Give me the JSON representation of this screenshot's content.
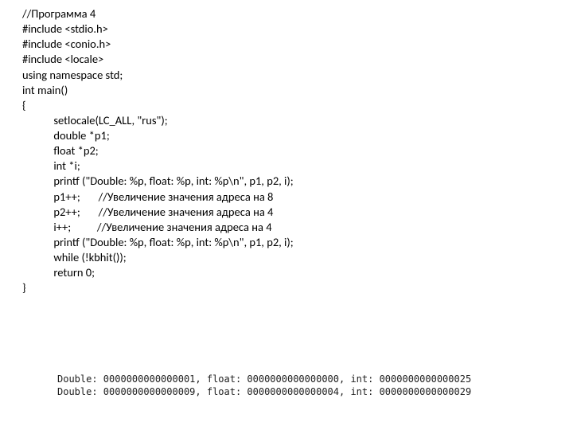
{
  "code": {
    "l0": "//Программа 4",
    "l1": "#include <stdio.h>",
    "l2": "#include <conio.h>",
    "l3": "#include <locale>",
    "l4": "using namespace std;",
    "l5": "int main()",
    "l6": "{",
    "l7": "            setlocale(LC_ALL, \"rus\");",
    "l8": "            double *p1;",
    "l9": "            float *p2;",
    "l10": "            int *i;",
    "l11": "            printf (\"Double: %p, float: %p, int: %p\\n\", p1, p2, i);",
    "l12": "            p1++;       //Увеличение значения адреса на 8",
    "l13": "            p2++;       //Увеличение значения адреса на 4",
    "l14": "            i++;          //Увеличение значения адреса на 4",
    "l15": "            printf (\"Double: %p, float: %p, int: %p\\n\", p1, p2, i);",
    "l16": "            while (!kbhit());",
    "l17": "            return 0;",
    "l18": "}"
  },
  "output": {
    "line1": "Double: 0000000000000001, float: 0000000000000000, int: 0000000000000025",
    "line2": "Double: 0000000000000009, float: 0000000000000004, int: 0000000000000029"
  }
}
